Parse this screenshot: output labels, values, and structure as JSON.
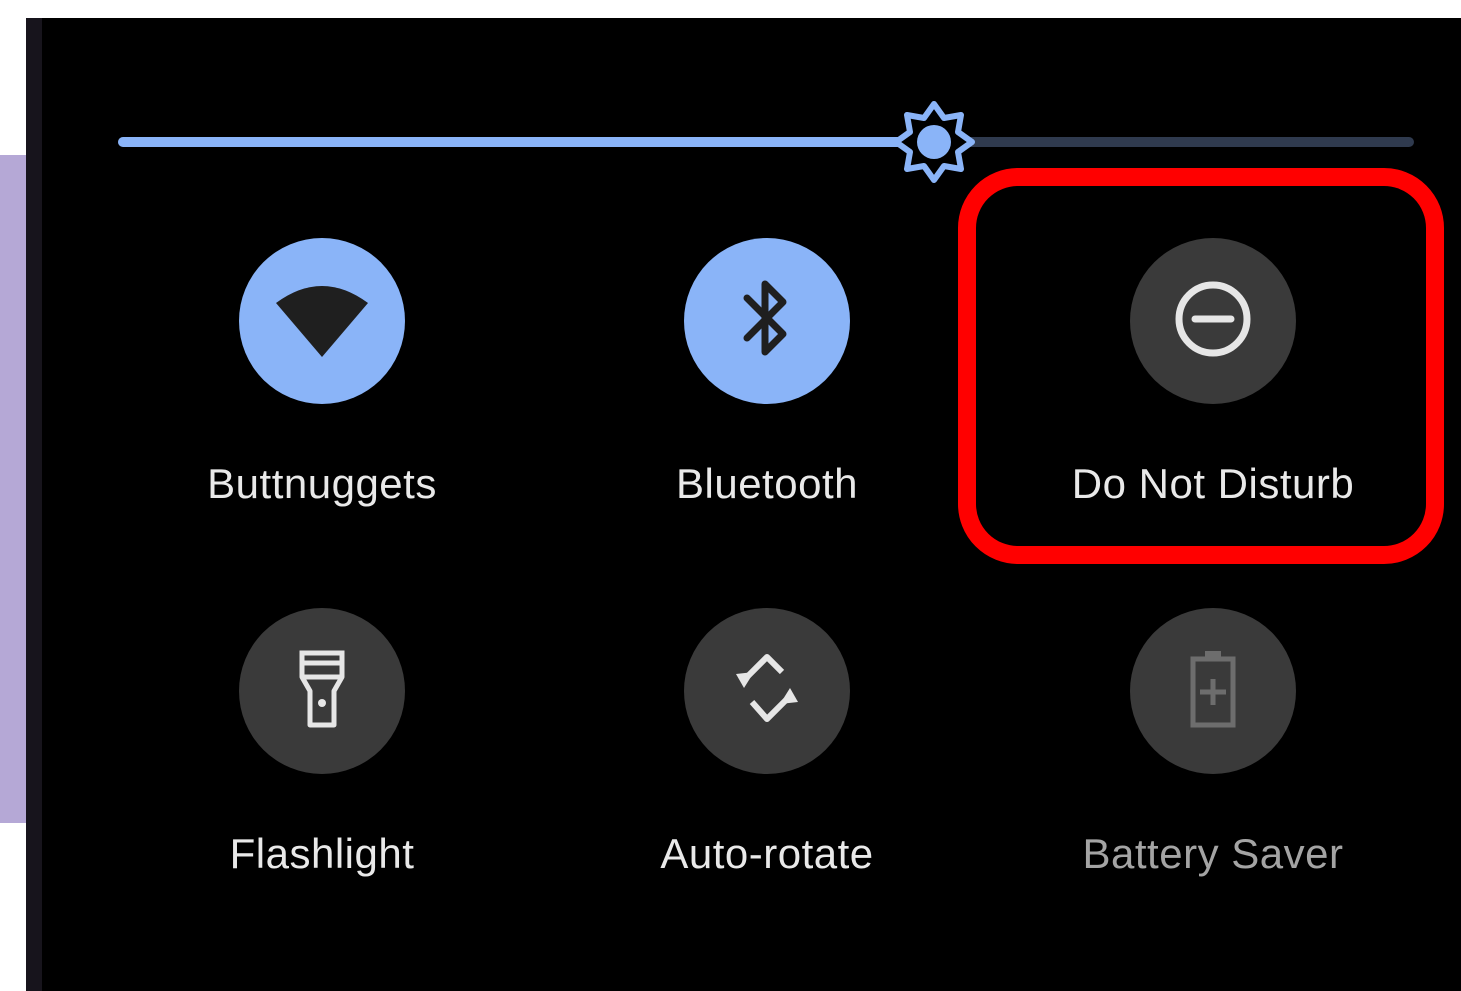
{
  "colors": {
    "accent": "#8ab4f8",
    "tile_off": "#3a3a3a",
    "panel_background": "#000000",
    "highlight": "#ff0000"
  },
  "brightness_slider": {
    "level_fraction": 0.63,
    "icon": "brightness-icon"
  },
  "tiles": [
    {
      "label": "Buttnuggets",
      "icon": "wifi-icon",
      "state": "on"
    },
    {
      "label": "Bluetooth",
      "icon": "bluetooth-icon",
      "state": "on"
    },
    {
      "label": "Do Not Disturb",
      "icon": "do-not-disturb-icon",
      "state": "off",
      "highlighted": true
    },
    {
      "label": "Flashlight",
      "icon": "flashlight-icon",
      "state": "off"
    },
    {
      "label": "Auto-rotate",
      "icon": "auto-rotate-icon",
      "state": "off"
    },
    {
      "label": "Battery Saver",
      "icon": "battery-saver-icon",
      "state": "unavailable"
    }
  ]
}
